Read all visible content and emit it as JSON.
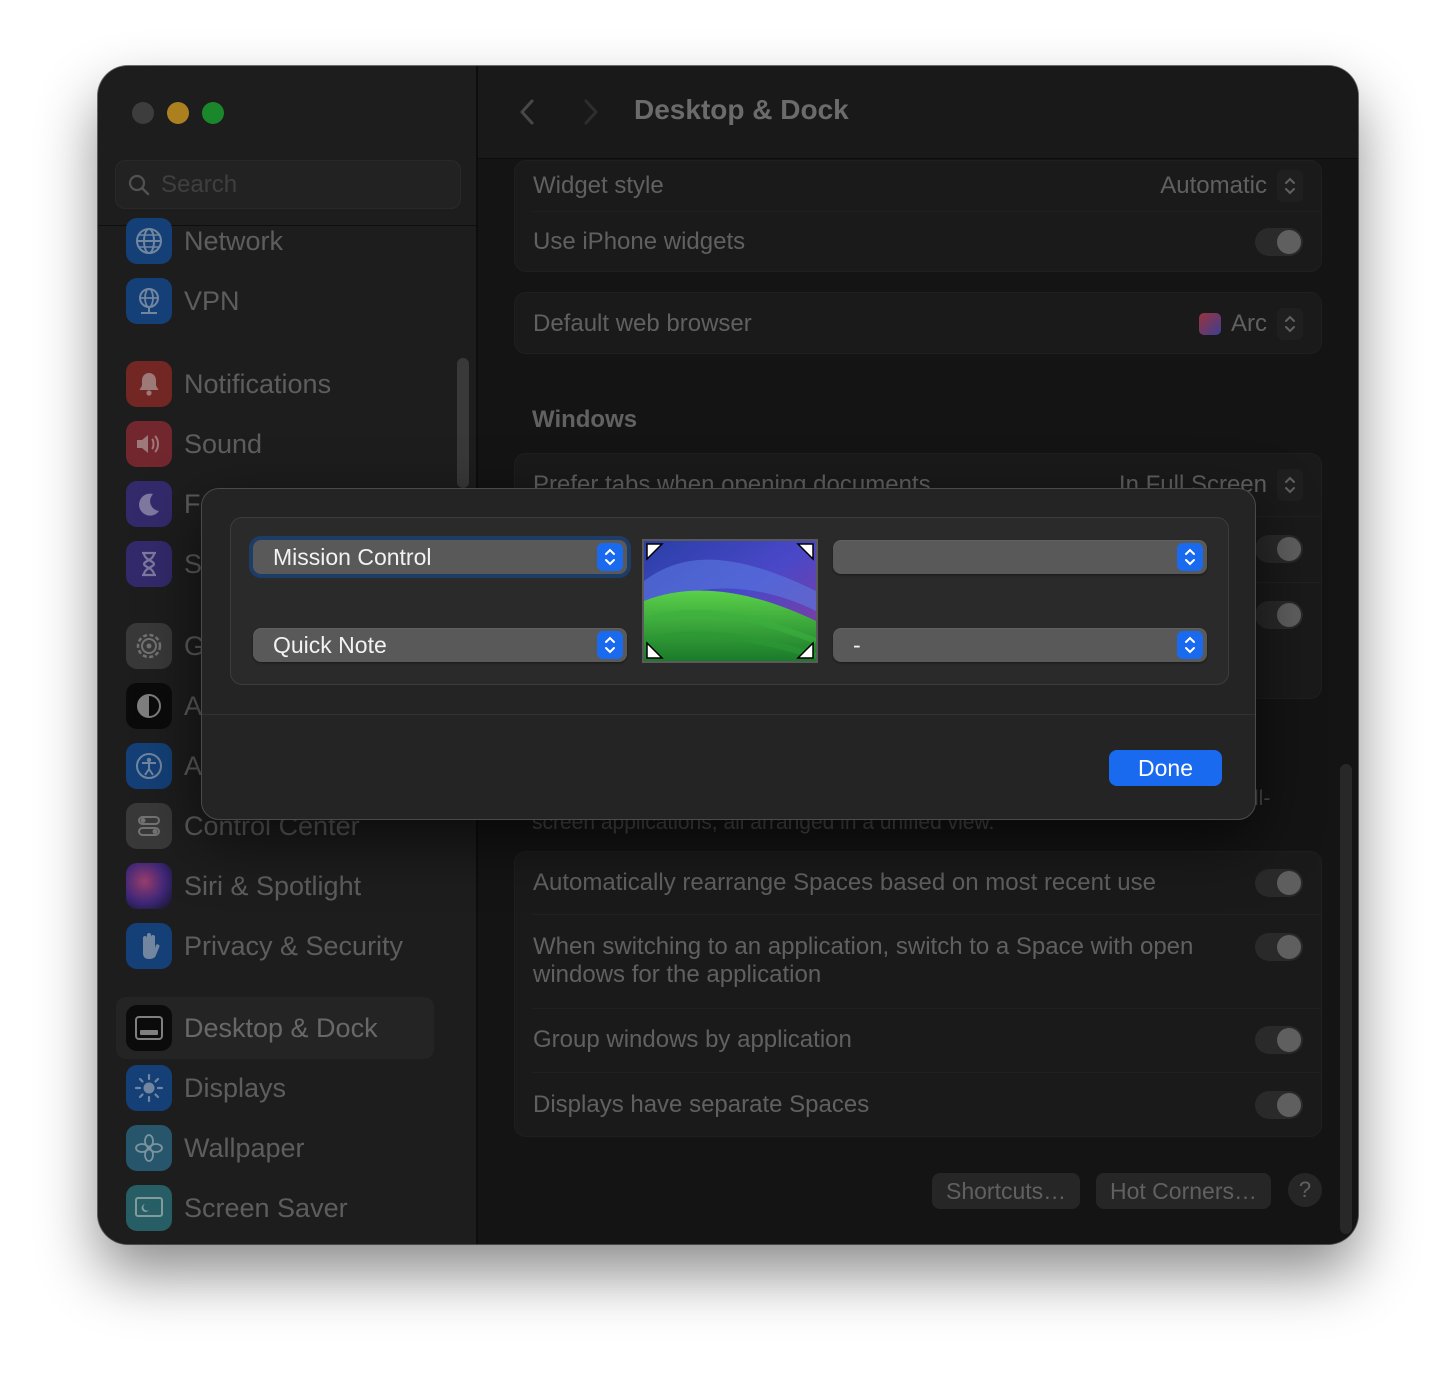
{
  "window": {
    "title": "Desktop & Dock"
  },
  "sidebar": {
    "search_placeholder": "Search",
    "items": [
      {
        "label": "Network",
        "icon": "globe-icon"
      },
      {
        "label": "VPN",
        "icon": "vpn-globe-icon"
      },
      {
        "label": "Notifications",
        "icon": "bell-icon"
      },
      {
        "label": "Sound",
        "icon": "speaker-icon"
      },
      {
        "label": "F",
        "icon": "moon-icon"
      },
      {
        "label": "S",
        "icon": "hourglass-icon"
      },
      {
        "label": "G",
        "icon": "gear-icon"
      },
      {
        "label": "A",
        "icon": "appearance-icon"
      },
      {
        "label": "A",
        "icon": "accessibility-icon"
      },
      {
        "label": "Control Center",
        "icon": "control-center-icon"
      },
      {
        "label": "Siri & Spotlight",
        "icon": "siri-icon"
      },
      {
        "label": "Privacy & Security",
        "icon": "hand-icon"
      },
      {
        "label": "Desktop & Dock",
        "icon": "dock-icon",
        "selected": true
      },
      {
        "label": "Displays",
        "icon": "sun-icon"
      },
      {
        "label": "Wallpaper",
        "icon": "flower-icon"
      },
      {
        "label": "Screen Saver",
        "icon": "screensaver-icon"
      }
    ]
  },
  "main": {
    "widget_style_label": "Widget style",
    "widget_style_value": "Automatic",
    "iphone_widgets_label": "Use iPhone widgets",
    "default_browser_label": "Default web browser",
    "default_browser_value": "Arc",
    "windows_section": "Windows",
    "prefer_tabs_label": "Prefer tabs when opening documents",
    "prefer_tabs_value": "In Full Screen",
    "mc_desc_tail": "ll-",
    "mc_desc_line2": "screen applications, all arranged in a unified view.",
    "rearrange_label": "Automatically rearrange Spaces based on most recent use",
    "switch_space_label_1": "When switching to an application, switch to a Space with open",
    "switch_space_label_2": "windows for the application",
    "group_windows_label": "Group windows by application",
    "separate_spaces_label": "Displays have separate Spaces",
    "shortcuts_button": "Shortcuts…",
    "hot_corners_button": "Hot Corners…",
    "help_button": "?"
  },
  "hot_corners_sheet": {
    "top_left": "Mission Control",
    "top_right": "",
    "bottom_left": "Quick Note",
    "bottom_right": "-",
    "done_button": "Done"
  },
  "colors": {
    "accent": "#1a6af0",
    "window_bg": "#1e1e1e",
    "sidebar_bg": "#2b2b2b"
  }
}
